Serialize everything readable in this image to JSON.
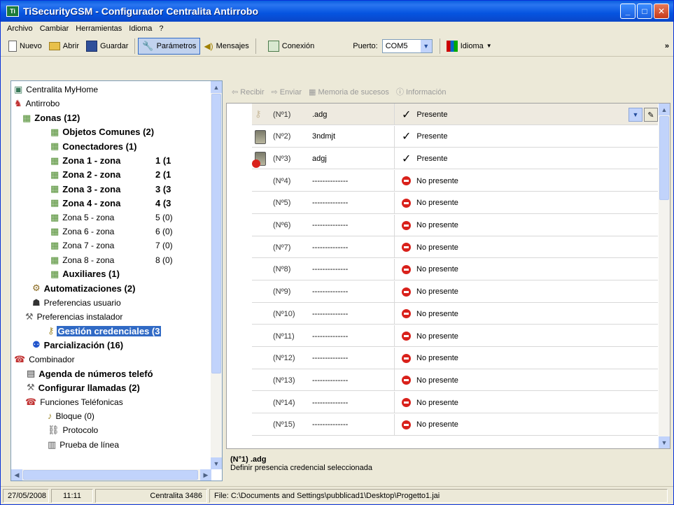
{
  "window": {
    "title": "TiSecurityGSM - Configurador Centralita Antirrobo"
  },
  "menu": [
    "Archivo",
    "Cambiar",
    "Herramientas",
    "Idioma",
    "?"
  ],
  "toolbar": {
    "nuevo": "Nuevo",
    "abrir": "Abrir",
    "guardar": "Guardar",
    "parametros": "Parámetros",
    "mensajes": "Mensajes",
    "conexion": "Conexión",
    "puerto_label": "Puerto:",
    "puerto_value": "COM5",
    "idioma": "Idioma",
    "overflow": "»"
  },
  "tree": [
    {
      "label": "Centralita MyHome",
      "bold": false
    },
    {
      "label": "Antirrobo",
      "bold": false
    },
    {
      "label": "Zonas (12)",
      "bold": true
    },
    {
      "label": "Objetos Comunes (2)",
      "bold": true
    },
    {
      "label": "Conectadores (1)",
      "bold": true
    },
    {
      "label": "Zona 1 - zona",
      "count": "1 (1",
      "bold": true
    },
    {
      "label": "Zona 2 - zona",
      "count": "2 (1",
      "bold": true
    },
    {
      "label": "Zona 3 - zona",
      "count": "3 (3",
      "bold": true
    },
    {
      "label": "Zona 4 - zona",
      "count": "4 (3",
      "bold": true
    },
    {
      "label": "Zona 5 - zona",
      "count": "5 (0)",
      "bold": false
    },
    {
      "label": "Zona 6 - zona",
      "count": "6 (0)",
      "bold": false
    },
    {
      "label": "Zona 7 - zona",
      "count": "7 (0)",
      "bold": false
    },
    {
      "label": "Zona 8 - zona",
      "count": "8 (0)",
      "bold": false
    },
    {
      "label": "Auxiliares (1)",
      "bold": true
    },
    {
      "label": "Automatizaciones (2)",
      "bold": true
    },
    {
      "label": "Preferencias usuario",
      "bold": false
    },
    {
      "label": "Preferencias instalador",
      "bold": false
    },
    {
      "label": "Gestión credenciales (3",
      "bold": true
    },
    {
      "label": "Parcialización (16)",
      "bold": true
    },
    {
      "label": "Combinador",
      "bold": false
    },
    {
      "label": "Agenda de números telefó",
      "bold": true
    },
    {
      "label": "Configurar llamadas (2)",
      "bold": true
    },
    {
      "label": "Funciones Teléfonicas",
      "bold": false
    },
    {
      "label": "Bloque (0)",
      "bold": false
    },
    {
      "label": "Protocolo",
      "bold": false
    },
    {
      "label": "Prueba de línea",
      "bold": false
    }
  ],
  "subtoolbar": {
    "recibir": "Recibir",
    "enviar": "Enviar",
    "memoria": "Memoria de sucesos",
    "info": "Información"
  },
  "rows": [
    {
      "num": "(Nº1)",
      "name": ".adg",
      "status": "Presente"
    },
    {
      "num": "(Nº2)",
      "name": "3ndmjt",
      "status": "Presente"
    },
    {
      "num": "(Nº3)",
      "name": "adgj",
      "status": "Presente"
    },
    {
      "num": "(Nº4)",
      "name": "--------------",
      "status": "No presente"
    },
    {
      "num": "(Nº5)",
      "name": "--------------",
      "status": "No presente"
    },
    {
      "num": "(Nº6)",
      "name": "--------------",
      "status": "No presente"
    },
    {
      "num": "(Nº7)",
      "name": "--------------",
      "status": "No presente"
    },
    {
      "num": "(Nº8)",
      "name": "--------------",
      "status": "No presente"
    },
    {
      "num": "(Nº9)",
      "name": "--------------",
      "status": "No presente"
    },
    {
      "num": "(Nº10)",
      "name": "--------------",
      "status": "No presente"
    },
    {
      "num": "(Nº11)",
      "name": "--------------",
      "status": "No presente"
    },
    {
      "num": "(Nº12)",
      "name": "--------------",
      "status": "No presente"
    },
    {
      "num": "(Nº13)",
      "name": "--------------",
      "status": "No presente"
    },
    {
      "num": "(Nº14)",
      "name": "--------------",
      "status": "No presente"
    },
    {
      "num": "(Nº15)",
      "name": "--------------",
      "status": "No presente"
    }
  ],
  "description": {
    "title": "(N°1) .adg",
    "text": "Definir presencia credencial seleccionada"
  },
  "status": {
    "date": "27/05/2008",
    "time": "11:11",
    "centralita": "Centralita 3486",
    "file": "File: C:\\Documents and Settings\\pubblicad1\\Desktop\\Progetto1.jai"
  }
}
